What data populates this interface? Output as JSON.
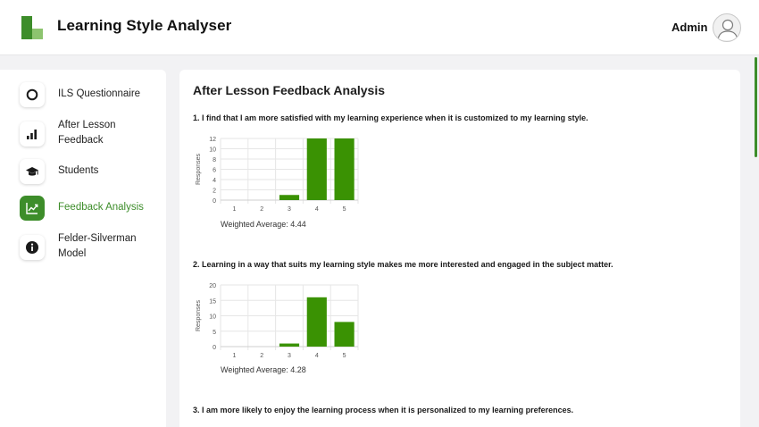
{
  "app": {
    "title": "Learning Style Analyser",
    "user": "Admin"
  },
  "colors": {
    "accent": "#3d8d2a",
    "bar": "#3a9203",
    "logo_light": "#8dc46f"
  },
  "sidebar": {
    "items": [
      {
        "label_lines": [
          "ILS Questionnaire"
        ],
        "icon": "circle-outline-icon",
        "active": false
      },
      {
        "label_lines": [
          "After Lesson",
          "Feedback"
        ],
        "icon": "bar-chart-icon",
        "active": false
      },
      {
        "label_lines": [
          "Students"
        ],
        "icon": "graduation-cap-icon",
        "active": false
      },
      {
        "label_lines": [
          "Feedback Analysis"
        ],
        "icon": "trending-up-icon",
        "active": true
      },
      {
        "label_lines": [
          "Felder-Silverman",
          "Model"
        ],
        "icon": "info-icon",
        "active": false
      }
    ]
  },
  "main": {
    "title": "After Lesson Feedback Analysis",
    "questions": [
      {
        "text": "1. I find that I am more satisfied with my learning experience when it is customized to my learning style.",
        "weighted_label": "Weighted Average: 4.44"
      },
      {
        "text": "2. Learning in a way that suits my learning style makes me more interested and engaged in the subject matter.",
        "weighted_label": "Weighted Average: 4.28"
      },
      {
        "text": "3. I am more likely to enjoy the learning process when it is personalized to my learning preferences."
      }
    ]
  },
  "chart_data": [
    {
      "type": "bar",
      "categories": [
        "1",
        "2",
        "3",
        "4",
        "5"
      ],
      "values": [
        0,
        0,
        1,
        12,
        12
      ],
      "ylabel": "Responses",
      "ylim": [
        0,
        12
      ],
      "yticks": [
        "0",
        "2",
        "4",
        "6",
        "8",
        "10",
        "12"
      ],
      "grid": true
    },
    {
      "type": "bar",
      "categories": [
        "1",
        "2",
        "3",
        "4",
        "5"
      ],
      "values": [
        0,
        0,
        1,
        16,
        8
      ],
      "ylabel": "Responses",
      "ylim": [
        0,
        20
      ],
      "yticks": [
        "0",
        "5",
        "10",
        "15",
        "20"
      ],
      "grid": true
    }
  ]
}
